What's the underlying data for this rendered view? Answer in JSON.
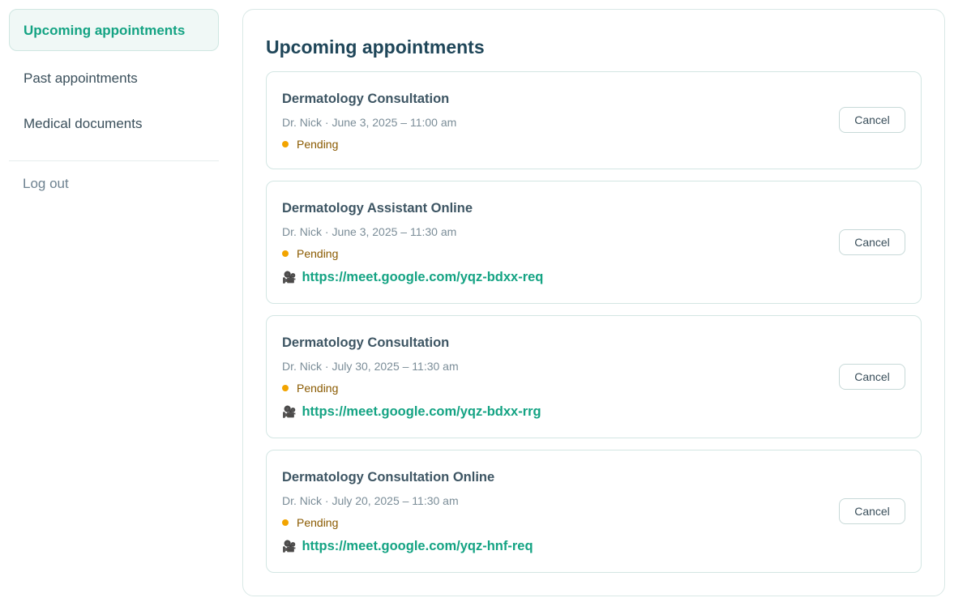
{
  "sidebar": {
    "items": [
      {
        "label": "Upcoming appointments",
        "active": true
      },
      {
        "label": "Past appointments",
        "active": false
      },
      {
        "label": "Medical documents",
        "active": false
      }
    ],
    "logout_label": "Log out"
  },
  "main": {
    "title": "Upcoming appointments",
    "cancel_label": "Cancel",
    "appointments": [
      {
        "title": "Dermatology Consultation",
        "meta": "Dr. Nick · June 3, 2025 – 11:00 am",
        "status": "Pending",
        "link": ""
      },
      {
        "title": "Dermatology Assistant Online",
        "meta": "Dr. Nick · June 3, 2025 – 11:30 am",
        "status": "Pending",
        "link": "https://meet.google.com/yqz-bdxx-req"
      },
      {
        "title": "Dermatology Consultation",
        "meta": "Dr. Nick · July 30, 2025 – 11:30 am",
        "status": "Pending",
        "link": "https://meet.google.com/yqz-bdxx-rrg"
      },
      {
        "title": "Dermatology Consultation Online",
        "meta": "Dr. Nick · July 20, 2025 – 11:30 am",
        "status": "Pending",
        "link": "https://meet.google.com/yqz-hnf-req"
      }
    ]
  },
  "colors": {
    "accent": "#14a383",
    "pending_dot": "#f2a400",
    "pending_text": "#8a5a00",
    "title": "#1f4659"
  },
  "icons": {
    "video": "video-camera-icon",
    "status": "status-dot-icon"
  }
}
